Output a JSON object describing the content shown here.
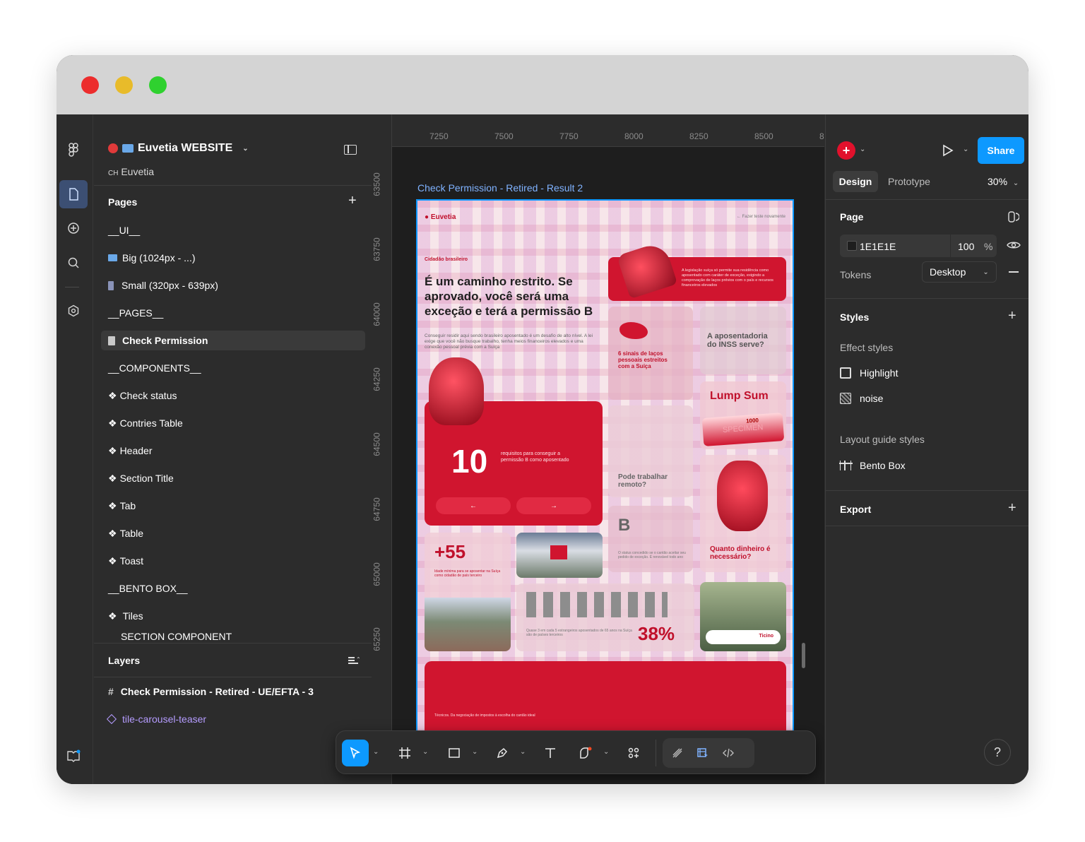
{
  "window": {
    "traffic_lights": [
      "#ec2d2d",
      "#e8bb2a",
      "#2fd12f"
    ]
  },
  "project": {
    "name": "Euvetia WEBSITE",
    "team_prefix": "CH",
    "team": "Euvetia"
  },
  "pages": {
    "header": "Pages",
    "items": [
      {
        "label": "__UI__"
      },
      {
        "label": "Big (1024px - ...)"
      },
      {
        "label": "Small (320px - 639px)"
      },
      {
        "label": "__PAGES__"
      },
      {
        "label": "Check Permission"
      },
      {
        "label": "__COMPONENTS__"
      },
      {
        "label": "Check status"
      },
      {
        "label": "Contries Table"
      },
      {
        "label": "Header"
      },
      {
        "label": "Section Title"
      },
      {
        "label": "Tab"
      },
      {
        "label": "Table"
      },
      {
        "label": "Toast"
      },
      {
        "label": "__BENTO BOX__"
      },
      {
        "label": "Tiles"
      },
      {
        "label": "SECTION COMPONENT"
      }
    ]
  },
  "layers": {
    "header": "Layers",
    "items": [
      {
        "label": "Check Permission - Retired - UE/EFTA - 3"
      },
      {
        "label": "tile-carousel-teaser"
      }
    ]
  },
  "rulers": {
    "top": [
      "7250",
      "7500",
      "7750",
      "8000",
      "8250",
      "8500",
      "8"
    ],
    "left": [
      "63500",
      "63750",
      "64000",
      "64250",
      "64500",
      "64750",
      "65000",
      "65250"
    ]
  },
  "canvas": {
    "frame_label": "Check Permission - Retired - Result 2",
    "design": {
      "brand": "Euvetia",
      "link": "← Fazer teste novamente",
      "eyebrow": "Cidadão brasileiro",
      "headline": "É um caminho restrito. Se aprovado, você será uma exceção e terá a permissão B",
      "body": "Conseguir residir aqui sendo brasileiro aposentado é um desafio de alto nível. A lei exige que você não busque trabalho, tenha meios financeiros elevados e uma conexão pessoal prévia com a Suíça",
      "law_text": "A legislação suíça só permite sua residência como aposentado com caráter de exceção, exigindo a comprovação de laços prévios com o país e recursos financeiros elevados",
      "tile_signs": "6 sinais de laços pessoais estreitos com a Suíça",
      "tile_inss": "A aposentadoria do INSS serve?",
      "tile_lump": "Lump Sum",
      "specimen": "SPECIMEN",
      "specimen_amount": "1000",
      "big_number": "10",
      "big_number_text": "requisitos para conseguir a permissão B como aposentado",
      "arrow_left": "←",
      "arrow_right": "→",
      "tile_remote": "Pode trabalhar remoto?",
      "tile_b": "B",
      "tile_b_text": "O status concedido se o cantão aceitar seu pedido de exceção. É renovável todo ano",
      "tile_money": "Quanto dinheiro é necessário?",
      "stat_55": "+55",
      "stat_55_text": "Idade mínima para se aposentar na Suíça como cidadão de país terceiro",
      "stat_38": "38%",
      "stat_38_text": "Quase 3 em cada 5 estrangeiros aposentados de 65 anos na Suíça são de países terceiros",
      "ticino": "Ticino",
      "footer_text": "Técnicos. Da negociação de impostos à escolha do cantão ideal"
    }
  },
  "right": {
    "tabs": {
      "design": "Design",
      "prototype": "Prototype",
      "zoom": "30%"
    },
    "share": "Share",
    "page": {
      "header": "Page",
      "color": "1E1E1E",
      "opacity": "100",
      "percent": "%",
      "tokens_label": "Tokens",
      "tokens_value": "Desktop"
    },
    "styles": {
      "header": "Styles",
      "effect_header": "Effect styles",
      "effects": [
        "Highlight",
        "noise"
      ],
      "layout_header": "Layout guide styles",
      "layout_items": [
        "Bento Box"
      ]
    },
    "export": {
      "header": "Export"
    },
    "help": "?"
  },
  "colors": {
    "accent": "#0d99ff",
    "brand_red": "#d0152f",
    "canvas_bg": "#1e1e1e",
    "panel_bg": "#2c2c2c"
  },
  "icons": [
    "figma-logo-icon",
    "file-icon",
    "add-circle-icon",
    "search-icon",
    "settings-icon",
    "book-icon",
    "sidebar-toggle-icon",
    "plus-icon",
    "component-icon",
    "frame-icon",
    "move-tool-icon",
    "rectangle-icon",
    "pen-icon",
    "text-icon",
    "shape-icon",
    "actions-icon",
    "draw-icon",
    "dev-mode-icon",
    "code-icon",
    "play-icon",
    "eye-icon",
    "minus-icon",
    "chevron-down-icon",
    "help-icon"
  ]
}
